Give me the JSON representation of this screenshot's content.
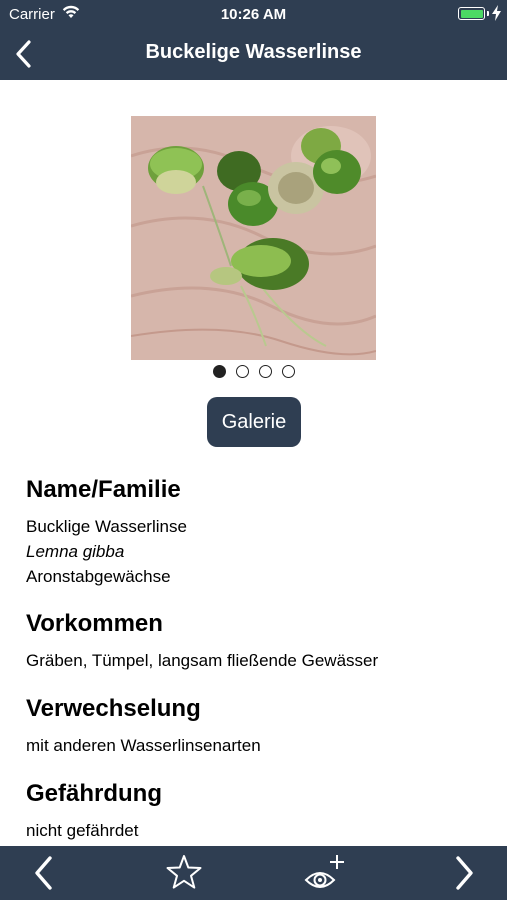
{
  "status": {
    "carrier": "Carrier",
    "time": "10:26 AM"
  },
  "nav": {
    "title": "Buckelige Wasserlinse"
  },
  "gallery": {
    "pages": 4,
    "active_page": 1,
    "button_label": "Galerie"
  },
  "sections": {
    "name": {
      "heading": "Name/Familie",
      "common_name": "Bucklige Wasserlinse",
      "latin_name": "Lemna gibba",
      "family": "Aronstabgewächse"
    },
    "occurrence": {
      "heading": "Vorkommen",
      "text": "Gräben, Tümpel, langsam fließende Gewässer"
    },
    "confusion": {
      "heading": "Verwechselung",
      "text": "mit anderen Wasserlinsenarten"
    },
    "threat": {
      "heading": "Gefährdung",
      "text": "nicht gefährdet"
    }
  },
  "tabbar": {
    "icons": [
      "chevron-left-icon",
      "star-icon",
      "eye-plus-icon",
      "chevron-right-icon"
    ]
  },
  "colors": {
    "bar": "#2f3e52",
    "battery": "#4cd964"
  }
}
